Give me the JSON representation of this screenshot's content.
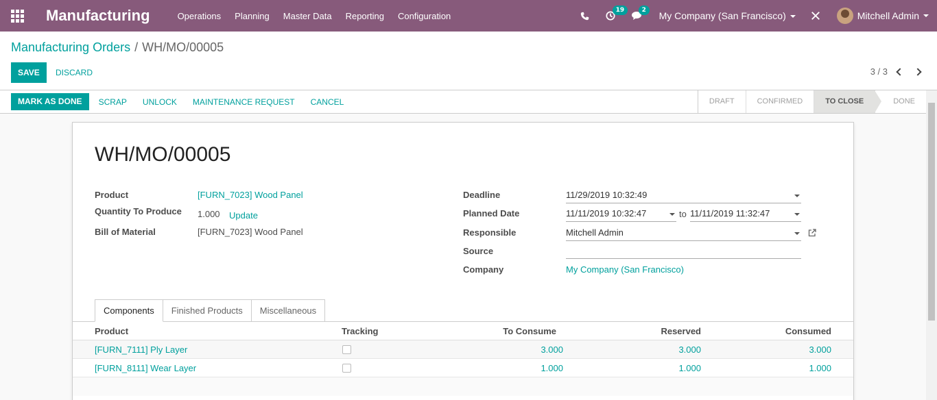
{
  "navbar": {
    "brand": "Manufacturing",
    "menu": [
      "Operations",
      "Planning",
      "Master Data",
      "Reporting",
      "Configuration"
    ],
    "activity_count": "19",
    "message_count": "2",
    "company": "My Company (San Francisco)",
    "user": "Mitchell Admin"
  },
  "breadcrumb": {
    "parent": "Manufacturing Orders",
    "separator": "/",
    "current": "WH/MO/00005"
  },
  "toolbar": {
    "save_label": "SAVE",
    "discard_label": "DISCARD",
    "pager": "3 / 3"
  },
  "status_buttons": {
    "mark_done": "MARK AS DONE",
    "scrap": "SCRAP",
    "unlock": "UNLOCK",
    "maintenance": "MAINTENANCE REQUEST",
    "cancel": "CANCEL"
  },
  "stages": {
    "draft": "DRAFT",
    "confirmed": "CONFIRMED",
    "to_close": "TO CLOSE",
    "done": "DONE",
    "active": "TO CLOSE"
  },
  "form": {
    "name": "WH/MO/00005",
    "labels": {
      "product": "Product",
      "quantity": "Quantity To Produce",
      "bom": "Bill of Material",
      "deadline": "Deadline",
      "planned_date": "Planned Date",
      "responsible": "Responsible",
      "source": "Source",
      "company": "Company"
    },
    "product": "[FURN_7023] Wood Panel",
    "quantity": "1.000",
    "update_label": "Update",
    "bom": "[FURN_7023] Wood Panel",
    "deadline": "11/29/2019 10:32:49",
    "planned_start": "11/11/2019 10:32:47",
    "to_label": "to",
    "planned_end": "11/11/2019 11:32:47",
    "responsible": "Mitchell Admin",
    "source": "",
    "company": "My Company (San Francisco)"
  },
  "tabs": [
    "Components",
    "Finished Products",
    "Miscellaneous"
  ],
  "table": {
    "headers": {
      "product": "Product",
      "tracking": "Tracking",
      "to_consume": "To Consume",
      "reserved": "Reserved",
      "consumed": "Consumed"
    },
    "rows": [
      {
        "product": "[FURN_7111] Ply Layer",
        "to_consume": "3.000",
        "reserved": "3.000",
        "consumed": "3.000"
      },
      {
        "product": "[FURN_8111] Wear Layer",
        "to_consume": "1.000",
        "reserved": "1.000",
        "consumed": "1.000"
      }
    ]
  }
}
